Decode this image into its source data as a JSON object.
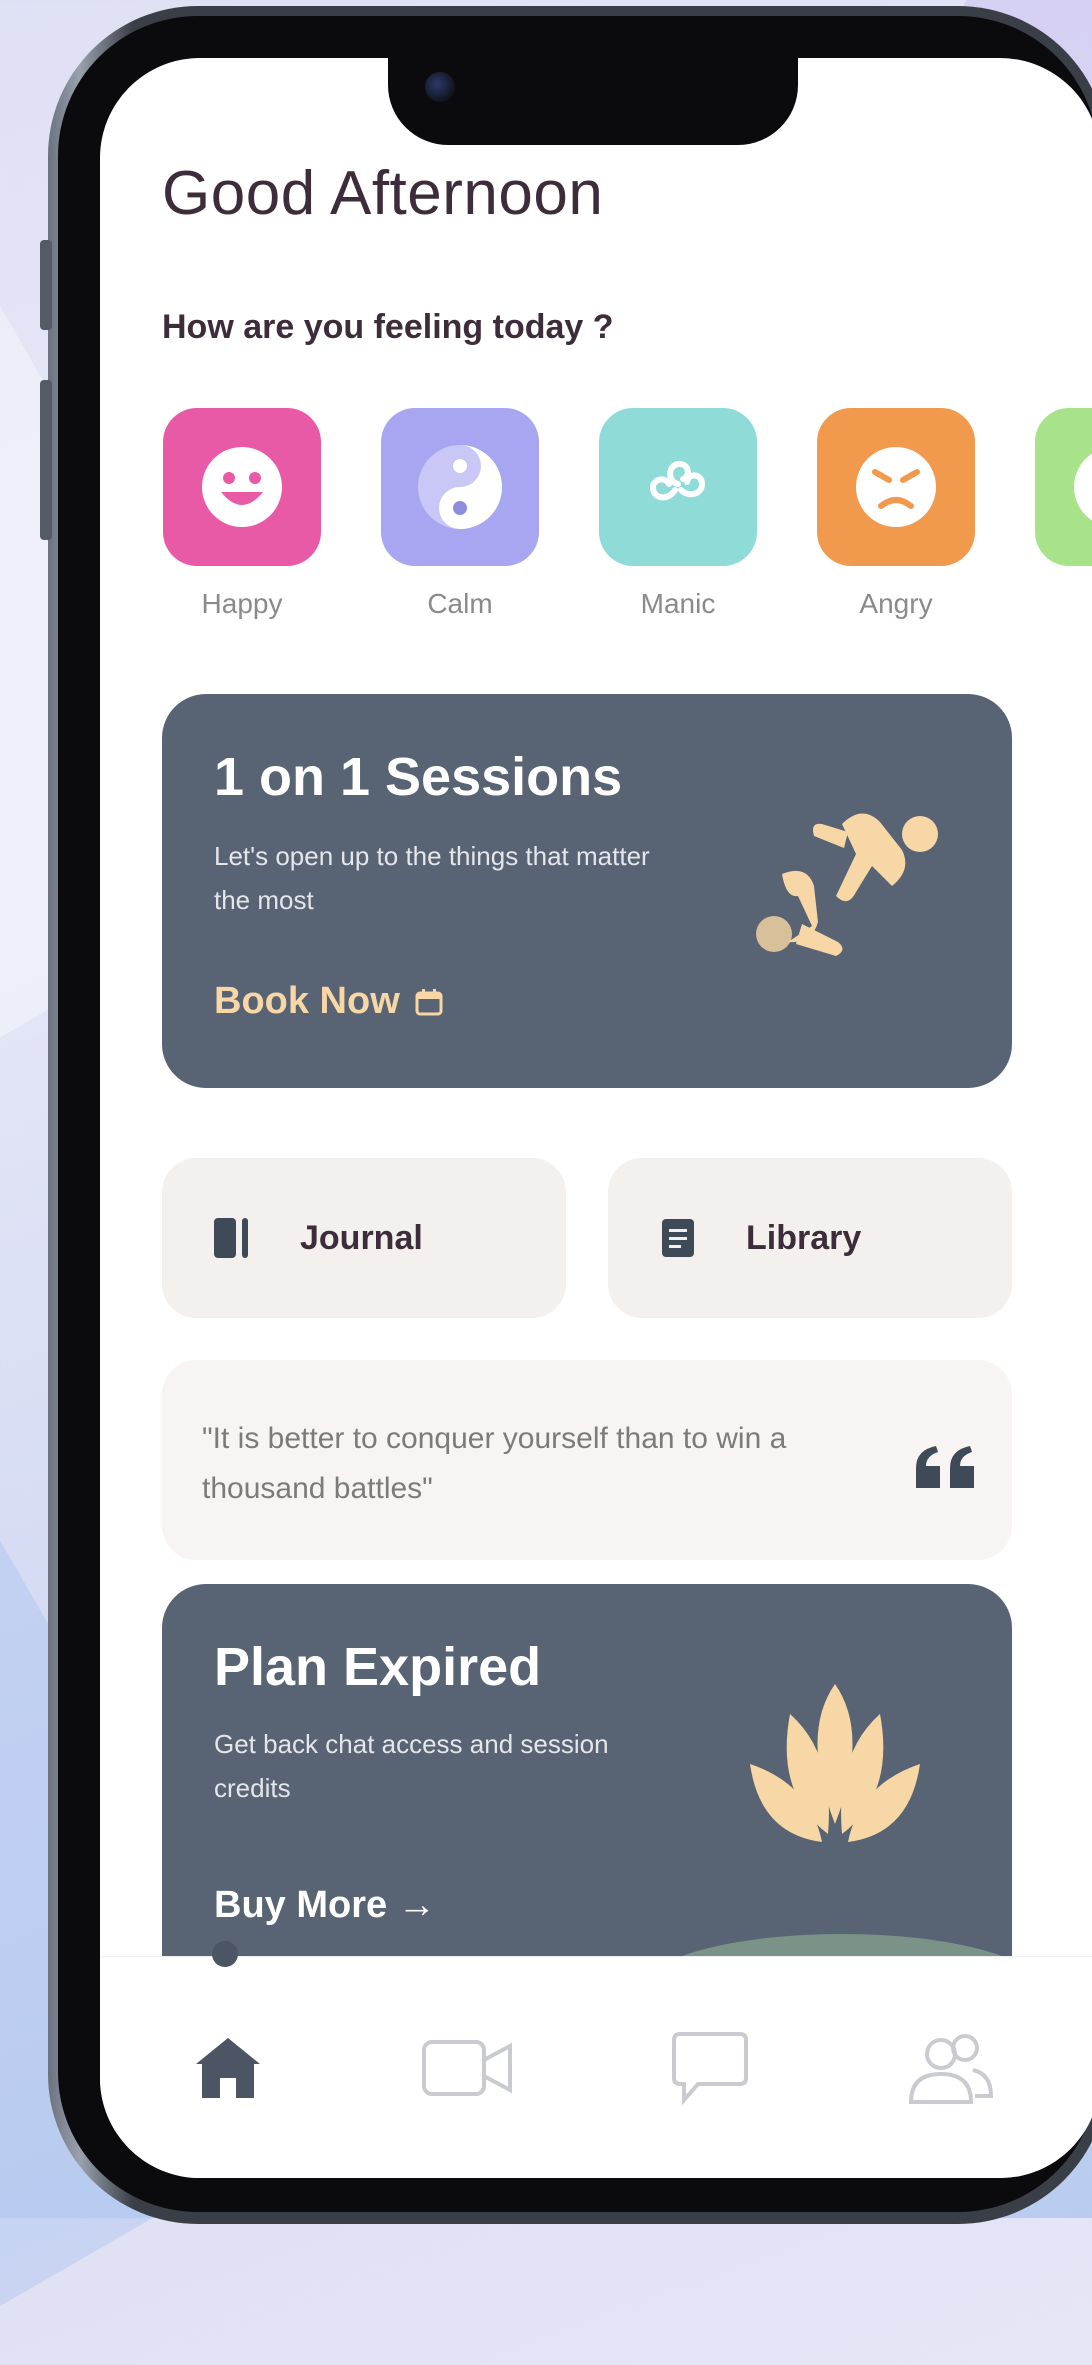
{
  "greeting": "Good Afternoon",
  "mood_prompt": "How are you feeling today ?",
  "moods": [
    {
      "label": "Happy",
      "color": "#e95aa6",
      "icon": "happy-face-icon"
    },
    {
      "label": "Calm",
      "color": "#a8a6f0",
      "icon": "yin-yang-icon"
    },
    {
      "label": "Manic",
      "color": "#8fdbd7",
      "icon": "triskelion-icon"
    },
    {
      "label": "Angry",
      "color": "#f19a4e",
      "icon": "angry-face-icon"
    },
    {
      "label": "",
      "color": "#a8e38a",
      "icon": "mood-icon"
    }
  ],
  "sessions_card": {
    "title": "1 on 1 Sessions",
    "description": "Let's open up to the things that matter the most",
    "cta": "Book Now",
    "cta_icon": "calendar-icon",
    "bg_color": "#586373",
    "accent_color": "#f7d7a6"
  },
  "quick_actions": [
    {
      "label": "Journal",
      "icon": "journal-icon"
    },
    {
      "label": "Library",
      "icon": "document-icon"
    }
  ],
  "quote": {
    "text": "\"It is better to conquer yourself than to win a thousand battles\"",
    "icon": "quote-icon"
  },
  "plan_card": {
    "title": "Plan Expired",
    "description": "Get back chat access and session credits",
    "cta": "Buy More →",
    "illustration": "lotus-icon"
  },
  "bottom_nav": [
    {
      "name": "home",
      "icon": "home-icon",
      "active": true
    },
    {
      "name": "video",
      "icon": "video-icon",
      "active": false
    },
    {
      "name": "chat",
      "icon": "chat-bubble-icon",
      "active": false
    },
    {
      "name": "community",
      "icon": "users-icon",
      "active": false
    }
  ]
}
